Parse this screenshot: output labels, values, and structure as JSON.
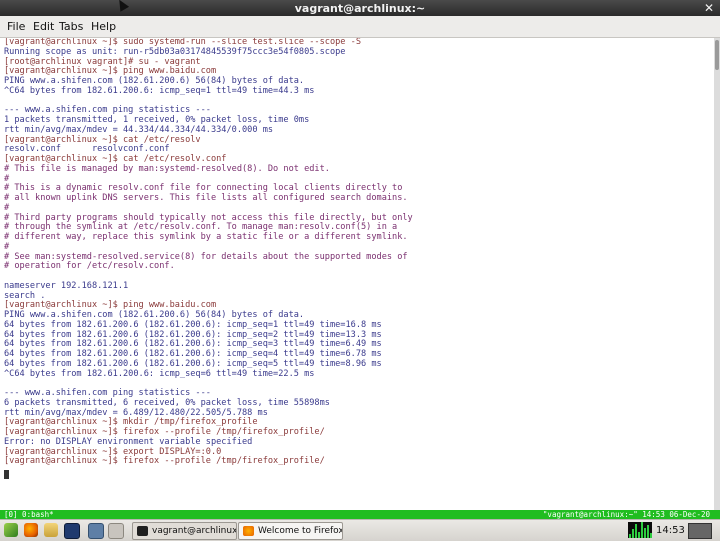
{
  "window": {
    "title": "vagrant@archlinux:~",
    "close_glyph": "✕"
  },
  "menu": [
    "File",
    "Edit",
    "Tabs",
    "Help"
  ],
  "terminal": {
    "lines": [
      {
        "t": "[vagrant@archlinux ~]$ sudo systemd-run --slice test.slice --scope -S",
        "k": "prompt"
      },
      {
        "t": "Running scope as unit: run-r5db03a03174845539f75ccc3e54f0805.scope",
        "k": "cmd"
      },
      {
        "t": "[root@archlinux vagrant]# su - vagrant",
        "k": "prompt"
      },
      {
        "t": "[vagrant@archlinux ~]$ ping www.baidu.com",
        "k": "prompt"
      },
      {
        "t": "PING www.a.shifen.com (182.61.200.6) 56(84) bytes of data.",
        "k": "cmd"
      },
      {
        "t": "^C64 bytes from 182.61.200.6: icmp_seq=1 ttl=49 time=44.3 ms",
        "k": "cmd"
      },
      {
        "t": "",
        "k": "cmd"
      },
      {
        "t": "--- www.a.shifen.com ping statistics ---",
        "k": "cmd"
      },
      {
        "t": "1 packets transmitted, 1 received, 0% packet loss, time 0ms",
        "k": "cmd"
      },
      {
        "t": "rtt min/avg/max/mdev = 44.334/44.334/44.334/0.000 ms",
        "k": "cmd"
      },
      {
        "t": "[vagrant@archlinux ~]$ cat /etc/resolv",
        "k": "prompt"
      },
      {
        "t": "resolv.conf      resolvconf.conf",
        "k": "cmd"
      },
      {
        "t": "[vagrant@archlinux ~]$ cat /etc/resolv.conf",
        "k": "prompt"
      },
      {
        "t": "# This file is managed by man:systemd-resolved(8). Do not edit.",
        "k": "comment"
      },
      {
        "t": "#",
        "k": "comment"
      },
      {
        "t": "# This is a dynamic resolv.conf file for connecting local clients directly to",
        "k": "comment"
      },
      {
        "t": "# all known uplink DNS servers. This file lists all configured search domains.",
        "k": "comment"
      },
      {
        "t": "#",
        "k": "comment"
      },
      {
        "t": "# Third party programs should typically not access this file directly, but only",
        "k": "comment"
      },
      {
        "t": "# through the symlink at /etc/resolv.conf. To manage man:resolv.conf(5) in a",
        "k": "comment"
      },
      {
        "t": "# different way, replace this symlink by a static file or a different symlink.",
        "k": "comment"
      },
      {
        "t": "#",
        "k": "comment"
      },
      {
        "t": "# See man:systemd-resolved.service(8) for details about the supported modes of",
        "k": "comment"
      },
      {
        "t": "# operation for /etc/resolv.conf.",
        "k": "comment"
      },
      {
        "t": "",
        "k": "cmd"
      },
      {
        "t": "nameserver 192.168.121.1",
        "k": "cmd"
      },
      {
        "t": "search .",
        "k": "cmd"
      },
      {
        "t": "[vagrant@archlinux ~]$ ping www.baidu.com",
        "k": "prompt"
      },
      {
        "t": "PING www.a.shifen.com (182.61.200.6) 56(84) bytes of data.",
        "k": "cmd"
      },
      {
        "t": "64 bytes from 182.61.200.6 (182.61.200.6): icmp_seq=1 ttl=49 time=16.8 ms",
        "k": "cmd"
      },
      {
        "t": "64 bytes from 182.61.200.6 (182.61.200.6): icmp_seq=2 ttl=49 time=13.3 ms",
        "k": "cmd"
      },
      {
        "t": "64 bytes from 182.61.200.6 (182.61.200.6): icmp_seq=3 ttl=49 time=6.49 ms",
        "k": "cmd"
      },
      {
        "t": "64 bytes from 182.61.200.6 (182.61.200.6): icmp_seq=4 ttl=49 time=6.78 ms",
        "k": "cmd"
      },
      {
        "t": "64 bytes from 182.61.200.6 (182.61.200.6): icmp_seq=5 ttl=49 time=8.96 ms",
        "k": "cmd"
      },
      {
        "t": "^C64 bytes from 182.61.200.6: icmp_seq=6 ttl=49 time=22.5 ms",
        "k": "cmd"
      },
      {
        "t": "",
        "k": "cmd"
      },
      {
        "t": "--- www.a.shifen.com ping statistics ---",
        "k": "cmd"
      },
      {
        "t": "6 packets transmitted, 6 received, 0% packet loss, time 55898ms",
        "k": "cmd"
      },
      {
        "t": "rtt min/avg/max/mdev = 6.489/12.480/22.505/5.788 ms",
        "k": "cmd"
      },
      {
        "t": "[vagrant@archlinux ~]$ mkdir /tmp/firefox_profile",
        "k": "prompt"
      },
      {
        "t": "[vagrant@archlinux ~]$ firefox --profile /tmp/firefox_profile/",
        "k": "prompt"
      },
      {
        "t": "Error: no DISPLAY environment variable specified",
        "k": "cmd"
      },
      {
        "t": "[vagrant@archlinux ~]$ export DISPLAY=:0.0",
        "k": "prompt"
      },
      {
        "t": "[vagrant@archlinux ~]$ firefox --profile /tmp/firefox_profile/",
        "k": "prompt"
      }
    ]
  },
  "statusbar": {
    "left": "[0] 0:bash*",
    "right": "\"vagrant@archlinux:~\" 14:53 06-Dec-20"
  },
  "taskbar": {
    "tasks": [
      {
        "label": "vagrant@archlinux:~"
      },
      {
        "label": "Welcome to Firefox"
      }
    ],
    "clock": "14:53",
    "colors": {
      "status_green": "#20bd20",
      "firefox_orange": "#e66000"
    }
  }
}
